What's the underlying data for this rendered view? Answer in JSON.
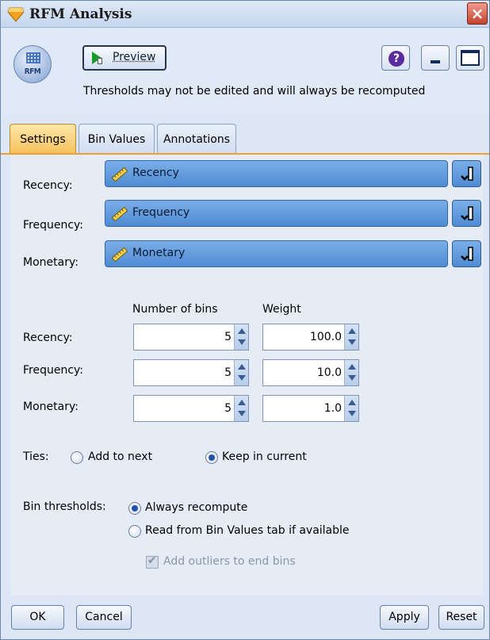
{
  "window": {
    "title": "RFM Analysis"
  },
  "toolbar": {
    "node_icon_label": "RFM",
    "preview_label": "Preview",
    "help_symbol": "?"
  },
  "info": {
    "message": "Thresholds may not be edited and will always be recomputed"
  },
  "tabs": [
    {
      "label": "Settings",
      "active": true
    },
    {
      "label": "Bin Values",
      "active": false
    },
    {
      "label": "Annotations",
      "active": false
    }
  ],
  "fields": [
    {
      "label": "Recency:",
      "value": "Recency"
    },
    {
      "label": "Frequency:",
      "value": "Frequency"
    },
    {
      "label": "Monetary:",
      "value": "Monetary"
    }
  ],
  "bins": {
    "col_bins": "Number of bins",
    "col_weight": "Weight",
    "rows": [
      {
        "label": "Recency:",
        "bins": "5",
        "weight": "100.0"
      },
      {
        "label": "Frequency:",
        "bins": "5",
        "weight": "10.0"
      },
      {
        "label": "Monetary:",
        "bins": "5",
        "weight": "1.0"
      }
    ]
  },
  "ties": {
    "label": "Ties:",
    "options": [
      {
        "label": "Add to next",
        "selected": false
      },
      {
        "label": "Keep in current",
        "selected": true
      }
    ]
  },
  "thresholds": {
    "label": "Bin thresholds:",
    "options": [
      {
        "label": "Always recompute",
        "selected": true
      },
      {
        "label": "Read from Bin Values tab if available",
        "selected": false
      }
    ],
    "outliers_label": "Add outliers to end bins",
    "outliers_checked": true,
    "outliers_enabled": false
  },
  "buttons": {
    "ok": "OK",
    "cancel": "Cancel",
    "apply": "Apply",
    "reset": "Reset"
  }
}
